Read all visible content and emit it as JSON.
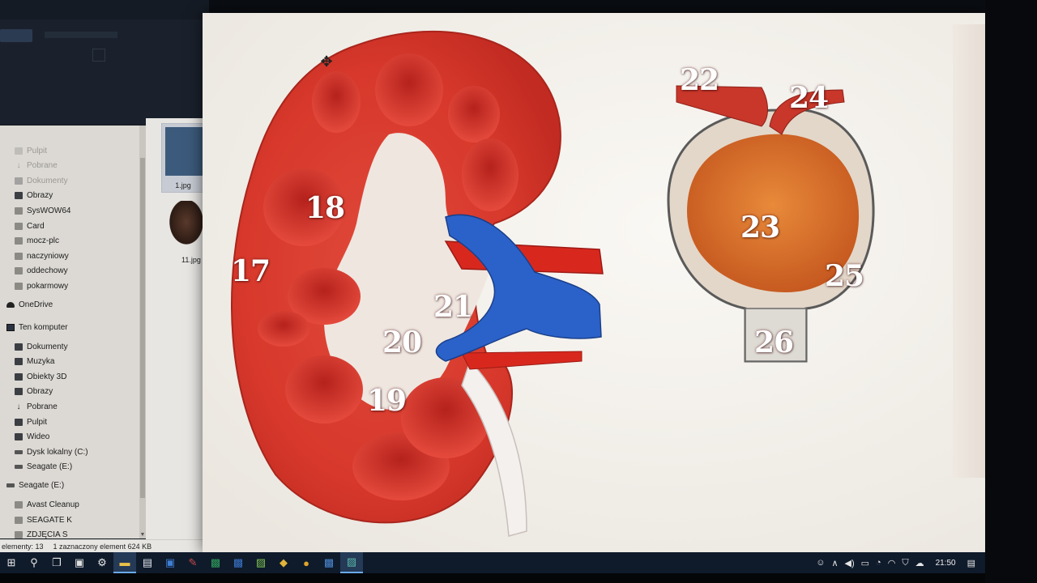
{
  "explorer": {
    "nav_items": [
      {
        "label": "Pulpit",
        "icon": "folder-icon",
        "pinned": true,
        "faded": true
      },
      {
        "label": "Pobrane",
        "icon": "download-arrow-icon",
        "pinned": true,
        "faded": true
      },
      {
        "label": "Dokumenty",
        "icon": "documents-icon",
        "pinned": true,
        "faded": true
      },
      {
        "label": "Obrazy",
        "icon": "pictures-icon",
        "pinned": true,
        "faded": false
      },
      {
        "label": "SysWOW64",
        "icon": "folder-icon",
        "pinned": true,
        "faded": false
      },
      {
        "label": "Card",
        "icon": "folder-icon",
        "pinned": true,
        "faded": false
      },
      {
        "label": "mocz-plc",
        "icon": "folder-icon",
        "pinned": false,
        "faded": false
      },
      {
        "label": "naczyniowy",
        "icon": "folder-icon",
        "pinned": false,
        "faded": false
      },
      {
        "label": "oddechowy",
        "icon": "folder-icon",
        "pinned": false,
        "faded": false
      },
      {
        "label": "pokarmowy",
        "icon": "folder-icon",
        "pinned": false,
        "faded": false
      },
      {
        "label": "OneDrive",
        "icon": "cloud-icon",
        "pinned": false,
        "faded": false,
        "root": true
      },
      {
        "label": "Ten komputer",
        "icon": "computer-icon",
        "pinned": false,
        "faded": false,
        "root": true
      },
      {
        "label": "Dokumenty",
        "icon": "documents-icon",
        "pinned": false,
        "faded": false
      },
      {
        "label": "Muzyka",
        "icon": "music-icon",
        "pinned": false,
        "faded": false
      },
      {
        "label": "Obiekty 3D",
        "icon": "objects-3d-icon",
        "pinned": false,
        "faded": false
      },
      {
        "label": "Obrazy",
        "icon": "pictures-icon",
        "pinned": false,
        "faded": false
      },
      {
        "label": "Pobrane",
        "icon": "download-arrow-icon",
        "pinned": false,
        "faded": false
      },
      {
        "label": "Pulpit",
        "icon": "desktop-icon",
        "pinned": false,
        "faded": false
      },
      {
        "label": "Wideo",
        "icon": "video-icon",
        "pinned": false,
        "faded": false
      },
      {
        "label": "Dysk lokalny (C:)",
        "icon": "drive-icon",
        "pinned": false,
        "faded": false
      },
      {
        "label": "Seagate (E:)",
        "icon": "drive-icon",
        "pinned": false,
        "faded": false
      },
      {
        "label": "Seagate (E:)",
        "icon": "drive-icon",
        "pinned": false,
        "faded": false,
        "root": true
      },
      {
        "label": "Avast Cleanup",
        "icon": "folder-icon",
        "pinned": false,
        "faded": false
      },
      {
        "label": "SEAGATE K",
        "icon": "folder-icon",
        "pinned": false,
        "faded": false
      },
      {
        "label": "ZDJĘCIA S",
        "icon": "folder-icon",
        "pinned": false,
        "faded": false
      }
    ],
    "files": [
      {
        "name": "1.jpg"
      },
      {
        "name": "11.jpg"
      }
    ],
    "status": {
      "count": "elementy: 13",
      "selection": "1 zaznaczony element  624 KB"
    }
  },
  "viewer": {
    "close_glyph": "×",
    "labels": [
      "17",
      "18",
      "19",
      "20",
      "21",
      "22",
      "23",
      "24",
      "25",
      "26"
    ]
  },
  "taskbar": {
    "items": [
      {
        "name": "start-button",
        "glyph": "⊞",
        "active": false
      },
      {
        "name": "search-button",
        "glyph": "⚲",
        "active": false
      },
      {
        "name": "task-view-button",
        "glyph": "❐",
        "active": false
      },
      {
        "name": "store-app",
        "glyph": "▣",
        "active": false,
        "color": "#e0e0e0"
      },
      {
        "name": "settings-app",
        "glyph": "⚙",
        "active": false
      },
      {
        "name": "file-explorer-app",
        "glyph": "▬",
        "active": true,
        "color": "#e8c14a"
      },
      {
        "name": "notepad-app",
        "glyph": "▤",
        "active": false,
        "color": "#dfe6ee"
      },
      {
        "name": "save-app",
        "glyph": "▣",
        "active": false,
        "color": "#3f7fd4"
      },
      {
        "name": "paint-app",
        "glyph": "✎",
        "active": false,
        "color": "#c94a4a"
      },
      {
        "name": "excel-app",
        "glyph": "▩",
        "active": false,
        "color": "#2f9e5b"
      },
      {
        "name": "word-app",
        "glyph": "▩",
        "active": false,
        "color": "#3a74c9"
      },
      {
        "name": "photos-app",
        "glyph": "▨",
        "active": false,
        "color": "#7fc24f"
      },
      {
        "name": "note-app",
        "glyph": "◆",
        "active": false,
        "color": "#e0b53a"
      },
      {
        "name": "chrome-app",
        "glyph": "●",
        "active": false,
        "color": "#e0a52a"
      },
      {
        "name": "outlook-app",
        "glyph": "▩",
        "active": false,
        "color": "#4a86d1"
      },
      {
        "name": "photo-viewer-app",
        "glyph": "▨",
        "active": true,
        "color": "#5bb8a8"
      }
    ],
    "tray": {
      "clock": "21:50"
    }
  }
}
